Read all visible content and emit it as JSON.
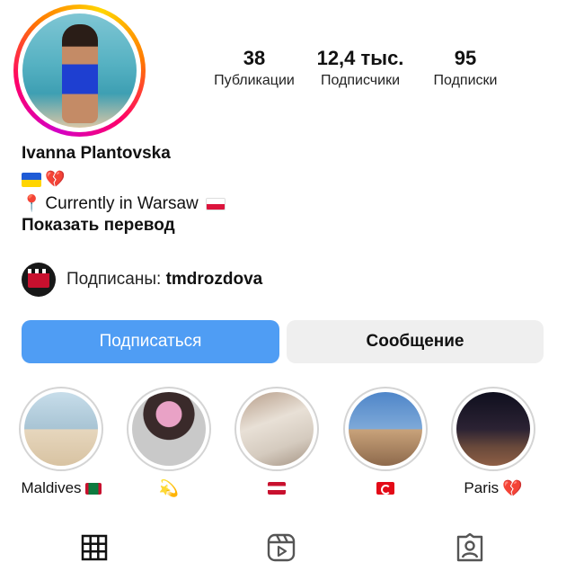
{
  "profile": {
    "name": "Ivanna Plantovska",
    "bio_line1": [
      "flag-ukraine",
      "broken-heart"
    ],
    "location_text": "Currently in Warsaw",
    "translate_label": "Показать перевод"
  },
  "stats": {
    "posts": {
      "value": "38",
      "label": "Публикации"
    },
    "followers": {
      "value": "12,4 тыс.",
      "label": "Подписчики"
    },
    "following": {
      "value": "95",
      "label": "Подписки"
    }
  },
  "followed_by": {
    "prefix": "Подписаны:",
    "username": "tmdrozdova"
  },
  "buttons": {
    "follow": "Подписаться",
    "message": "Сообщение"
  },
  "highlights": [
    {
      "label": "Maldives",
      "emoji": "flag-maldives"
    },
    {
      "label": "",
      "emoji": "dizzy-star"
    },
    {
      "label": "",
      "emoji": "flag-austria"
    },
    {
      "label": "",
      "emoji": "flag-turkey"
    },
    {
      "label": "Paris",
      "emoji": "broken-heart"
    }
  ],
  "tabs": [
    "grid-icon",
    "reels-icon",
    "tagged-icon"
  ],
  "colors": {
    "follow_button": "#4f9df4",
    "message_button": "#efefef"
  }
}
